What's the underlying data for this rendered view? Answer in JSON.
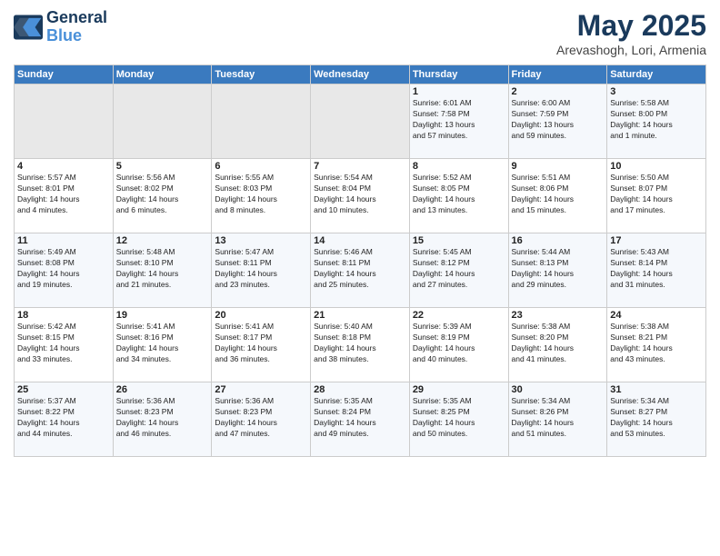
{
  "header": {
    "logo_line1": "General",
    "logo_line2": "Blue",
    "month": "May 2025",
    "location": "Arevashogh, Lori, Armenia"
  },
  "weekdays": [
    "Sunday",
    "Monday",
    "Tuesday",
    "Wednesday",
    "Thursday",
    "Friday",
    "Saturday"
  ],
  "rows": [
    [
      {
        "day": "",
        "empty": true,
        "info": ""
      },
      {
        "day": "",
        "empty": true,
        "info": ""
      },
      {
        "day": "",
        "empty": true,
        "info": ""
      },
      {
        "day": "",
        "empty": true,
        "info": ""
      },
      {
        "day": "1",
        "empty": false,
        "info": "Sunrise: 6:01 AM\nSunset: 7:58 PM\nDaylight: 13 hours\nand 57 minutes."
      },
      {
        "day": "2",
        "empty": false,
        "info": "Sunrise: 6:00 AM\nSunset: 7:59 PM\nDaylight: 13 hours\nand 59 minutes."
      },
      {
        "day": "3",
        "empty": false,
        "info": "Sunrise: 5:58 AM\nSunset: 8:00 PM\nDaylight: 14 hours\nand 1 minute."
      }
    ],
    [
      {
        "day": "4",
        "empty": false,
        "info": "Sunrise: 5:57 AM\nSunset: 8:01 PM\nDaylight: 14 hours\nand 4 minutes."
      },
      {
        "day": "5",
        "empty": false,
        "info": "Sunrise: 5:56 AM\nSunset: 8:02 PM\nDaylight: 14 hours\nand 6 minutes."
      },
      {
        "day": "6",
        "empty": false,
        "info": "Sunrise: 5:55 AM\nSunset: 8:03 PM\nDaylight: 14 hours\nand 8 minutes."
      },
      {
        "day": "7",
        "empty": false,
        "info": "Sunrise: 5:54 AM\nSunset: 8:04 PM\nDaylight: 14 hours\nand 10 minutes."
      },
      {
        "day": "8",
        "empty": false,
        "info": "Sunrise: 5:52 AM\nSunset: 8:05 PM\nDaylight: 14 hours\nand 13 minutes."
      },
      {
        "day": "9",
        "empty": false,
        "info": "Sunrise: 5:51 AM\nSunset: 8:06 PM\nDaylight: 14 hours\nand 15 minutes."
      },
      {
        "day": "10",
        "empty": false,
        "info": "Sunrise: 5:50 AM\nSunset: 8:07 PM\nDaylight: 14 hours\nand 17 minutes."
      }
    ],
    [
      {
        "day": "11",
        "empty": false,
        "info": "Sunrise: 5:49 AM\nSunset: 8:08 PM\nDaylight: 14 hours\nand 19 minutes."
      },
      {
        "day": "12",
        "empty": false,
        "info": "Sunrise: 5:48 AM\nSunset: 8:10 PM\nDaylight: 14 hours\nand 21 minutes."
      },
      {
        "day": "13",
        "empty": false,
        "info": "Sunrise: 5:47 AM\nSunset: 8:11 PM\nDaylight: 14 hours\nand 23 minutes."
      },
      {
        "day": "14",
        "empty": false,
        "info": "Sunrise: 5:46 AM\nSunset: 8:11 PM\nDaylight: 14 hours\nand 25 minutes."
      },
      {
        "day": "15",
        "empty": false,
        "info": "Sunrise: 5:45 AM\nSunset: 8:12 PM\nDaylight: 14 hours\nand 27 minutes."
      },
      {
        "day": "16",
        "empty": false,
        "info": "Sunrise: 5:44 AM\nSunset: 8:13 PM\nDaylight: 14 hours\nand 29 minutes."
      },
      {
        "day": "17",
        "empty": false,
        "info": "Sunrise: 5:43 AM\nSunset: 8:14 PM\nDaylight: 14 hours\nand 31 minutes."
      }
    ],
    [
      {
        "day": "18",
        "empty": false,
        "info": "Sunrise: 5:42 AM\nSunset: 8:15 PM\nDaylight: 14 hours\nand 33 minutes."
      },
      {
        "day": "19",
        "empty": false,
        "info": "Sunrise: 5:41 AM\nSunset: 8:16 PM\nDaylight: 14 hours\nand 34 minutes."
      },
      {
        "day": "20",
        "empty": false,
        "info": "Sunrise: 5:41 AM\nSunset: 8:17 PM\nDaylight: 14 hours\nand 36 minutes."
      },
      {
        "day": "21",
        "empty": false,
        "info": "Sunrise: 5:40 AM\nSunset: 8:18 PM\nDaylight: 14 hours\nand 38 minutes."
      },
      {
        "day": "22",
        "empty": false,
        "info": "Sunrise: 5:39 AM\nSunset: 8:19 PM\nDaylight: 14 hours\nand 40 minutes."
      },
      {
        "day": "23",
        "empty": false,
        "info": "Sunrise: 5:38 AM\nSunset: 8:20 PM\nDaylight: 14 hours\nand 41 minutes."
      },
      {
        "day": "24",
        "empty": false,
        "info": "Sunrise: 5:38 AM\nSunset: 8:21 PM\nDaylight: 14 hours\nand 43 minutes."
      }
    ],
    [
      {
        "day": "25",
        "empty": false,
        "info": "Sunrise: 5:37 AM\nSunset: 8:22 PM\nDaylight: 14 hours\nand 44 minutes."
      },
      {
        "day": "26",
        "empty": false,
        "info": "Sunrise: 5:36 AM\nSunset: 8:23 PM\nDaylight: 14 hours\nand 46 minutes."
      },
      {
        "day": "27",
        "empty": false,
        "info": "Sunrise: 5:36 AM\nSunset: 8:23 PM\nDaylight: 14 hours\nand 47 minutes."
      },
      {
        "day": "28",
        "empty": false,
        "info": "Sunrise: 5:35 AM\nSunset: 8:24 PM\nDaylight: 14 hours\nand 49 minutes."
      },
      {
        "day": "29",
        "empty": false,
        "info": "Sunrise: 5:35 AM\nSunset: 8:25 PM\nDaylight: 14 hours\nand 50 minutes."
      },
      {
        "day": "30",
        "empty": false,
        "info": "Sunrise: 5:34 AM\nSunset: 8:26 PM\nDaylight: 14 hours\nand 51 minutes."
      },
      {
        "day": "31",
        "empty": false,
        "info": "Sunrise: 5:34 AM\nSunset: 8:27 PM\nDaylight: 14 hours\nand 53 minutes."
      }
    ]
  ]
}
